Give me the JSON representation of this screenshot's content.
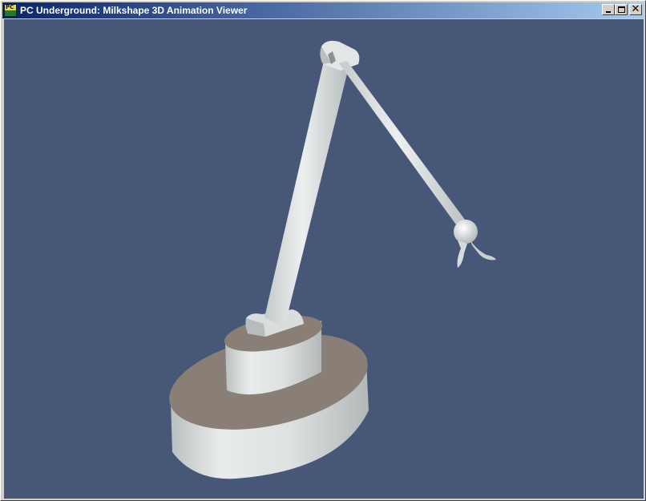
{
  "window": {
    "title": "PC Underground: Milkshape 3D Animation Viewer",
    "icon_text": "PC",
    "minimize_icon": "minimize-icon",
    "maximize_icon": "maximize-icon",
    "close_icon": "close-icon",
    "close_glyph": "✕"
  },
  "viewport": {
    "background": "#465777",
    "model_color": "#dfe3e3",
    "shadow_color": "#8a7f76"
  }
}
